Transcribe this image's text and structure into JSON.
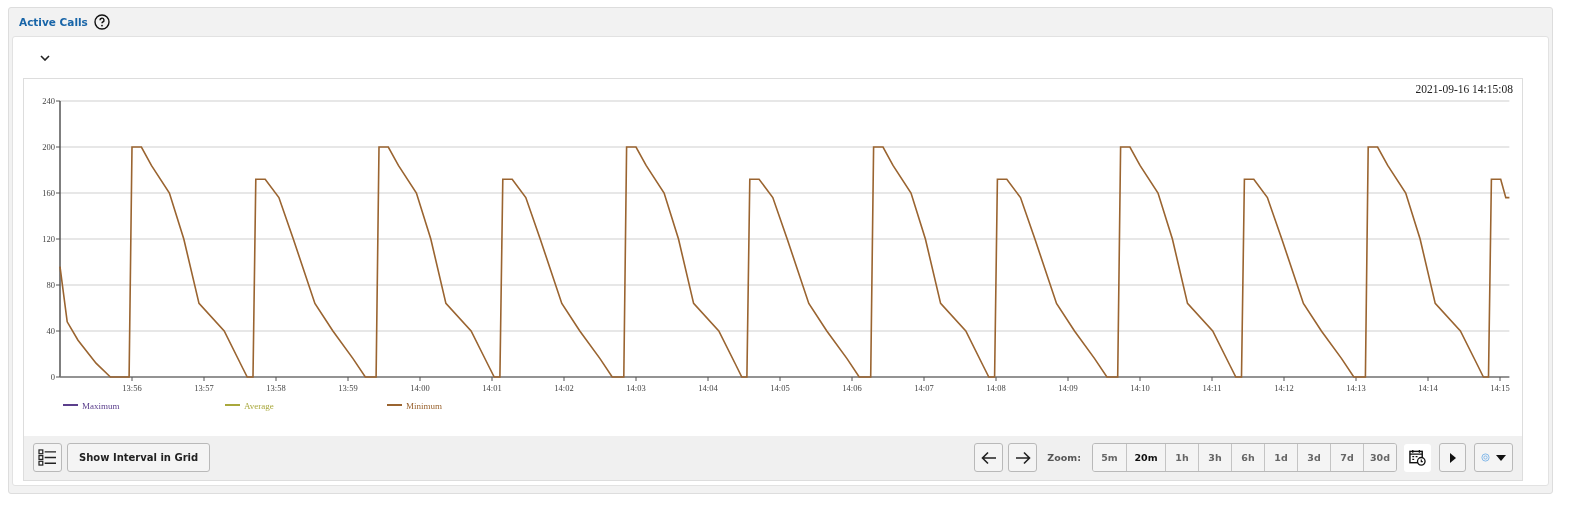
{
  "panel": {
    "title": "Active Calls"
  },
  "chart": {
    "timestamp": "2021-09-16 14:15:08",
    "chart_data": {
      "type": "line",
      "grid": true,
      "legend": "bottom",
      "xlim": [
        835,
        855.13
      ],
      "ylim": [
        0,
        240
      ],
      "yticks": [
        0,
        40,
        80,
        120,
        160,
        200,
        240
      ],
      "xticks": [
        {
          "value": 836,
          "label": "13:56"
        },
        {
          "value": 837,
          "label": "13:57"
        },
        {
          "value": 838,
          "label": "13:58"
        },
        {
          "value": 839,
          "label": "13:59"
        },
        {
          "value": 840,
          "label": "14:00"
        },
        {
          "value": 841,
          "label": "14:01"
        },
        {
          "value": 842,
          "label": "14:02"
        },
        {
          "value": 843,
          "label": "14:03"
        },
        {
          "value": 844,
          "label": "14:04"
        },
        {
          "value": 845,
          "label": "14:05"
        },
        {
          "value": 846,
          "label": "14:06"
        },
        {
          "value": 847,
          "label": "14:07"
        },
        {
          "value": 848,
          "label": "14:08"
        },
        {
          "value": 849,
          "label": "14:09"
        },
        {
          "value": 850,
          "label": "14:10"
        },
        {
          "value": 851,
          "label": "14:11"
        },
        {
          "value": 852,
          "label": "14:12"
        },
        {
          "value": 853,
          "label": "14:13"
        },
        {
          "value": 854,
          "label": "14:14"
        },
        {
          "value": 855,
          "label": "14:15"
        }
      ],
      "x": [
        835,
        835.1,
        835.25,
        835.5,
        835.7,
        835.96,
        836,
        836.13,
        836.27,
        836.52,
        836.72,
        836.93,
        837.28,
        837.52,
        837.6,
        837.68,
        837.72,
        837.85,
        838.04,
        838.24,
        838.54,
        838.79,
        839.07,
        839.24,
        839.39,
        839.43,
        839.56,
        839.7,
        839.95,
        840.15,
        840.36,
        840.71,
        840.95,
        841.03,
        841.11,
        841.15,
        841.28,
        841.47,
        841.67,
        841.97,
        842.22,
        842.5,
        842.67,
        842.83,
        842.87,
        843,
        843.14,
        843.39,
        843.59,
        843.8,
        844.15,
        844.39,
        844.47,
        844.54,
        844.58,
        844.71,
        844.9,
        845.1,
        845.4,
        845.65,
        845.93,
        846.1,
        846.26,
        846.3,
        846.43,
        846.57,
        846.82,
        847.02,
        847.23,
        847.58,
        847.82,
        847.9,
        847.98,
        848.02,
        848.15,
        848.34,
        848.54,
        848.84,
        849.09,
        849.37,
        849.54,
        849.69,
        849.73,
        849.86,
        850,
        850.25,
        850.45,
        850.66,
        851.01,
        851.25,
        851.33,
        851.41,
        851.45,
        851.58,
        851.77,
        851.97,
        852.27,
        852.52,
        852.8,
        852.97,
        853.13,
        853.17,
        853.3,
        853.44,
        853.69,
        853.89,
        854.1,
        854.45,
        854.69,
        854.77,
        854.84,
        854.88,
        855.01,
        855.08,
        855.13
      ],
      "series": [
        {
          "name": "Maximum",
          "color": "#5b3f8c",
          "values": [
            null,
            null,
            null,
            null,
            null,
            null,
            null,
            null,
            null,
            null,
            null,
            null,
            null,
            null,
            null,
            null,
            null,
            null,
            null,
            null,
            null,
            null,
            null,
            null,
            null,
            null,
            null,
            null,
            null,
            null,
            null,
            null,
            null,
            null,
            null,
            null,
            null,
            null,
            null,
            null,
            null,
            null,
            null,
            null,
            null,
            null,
            null,
            null,
            null,
            null,
            null,
            null,
            null,
            null,
            null,
            null,
            null,
            null,
            null,
            null,
            null,
            null,
            null,
            null,
            null,
            null,
            null,
            null,
            null,
            null,
            null,
            null,
            null,
            null,
            null,
            null,
            null,
            null,
            null,
            null,
            null,
            null,
            null,
            null,
            null,
            null,
            null,
            null,
            null,
            null,
            null,
            null,
            null,
            null,
            null,
            null,
            null,
            null,
            null,
            null,
            null,
            null,
            null,
            null,
            null,
            null,
            null,
            null,
            null,
            null,
            null,
            null,
            null,
            null,
            null
          ]
        },
        {
          "name": "Average",
          "color": "#a9a83c",
          "values": [
            null,
            null,
            null,
            null,
            null,
            null,
            null,
            null,
            null,
            null,
            null,
            null,
            null,
            null,
            null,
            null,
            null,
            null,
            null,
            null,
            null,
            null,
            null,
            null,
            null,
            null,
            null,
            null,
            null,
            null,
            null,
            null,
            null,
            null,
            null,
            null,
            null,
            null,
            null,
            null,
            null,
            null,
            null,
            null,
            null,
            null,
            null,
            null,
            null,
            null,
            null,
            null,
            null,
            null,
            null,
            null,
            null,
            null,
            null,
            null,
            null,
            null,
            null,
            null,
            null,
            null,
            null,
            null,
            null,
            null,
            null,
            null,
            null,
            null,
            null,
            null,
            null,
            null,
            null,
            null,
            null,
            null,
            null,
            null,
            null,
            null,
            null,
            null,
            null,
            null,
            null,
            null,
            null,
            null,
            null,
            null,
            null,
            null,
            null,
            null,
            null,
            null,
            null,
            null,
            null,
            null,
            null,
            null,
            null,
            null,
            null,
            null,
            null,
            null,
            null
          ]
        },
        {
          "name": "Minimum",
          "color": "#9a6430",
          "values": [
            96,
            48,
            32,
            12,
            0,
            0,
            200,
            200,
            184,
            160,
            120,
            64,
            40,
            10,
            0,
            0,
            172,
            172,
            156,
            120,
            64,
            40,
            16,
            0,
            0,
            200,
            200,
            184,
            160,
            120,
            64,
            40,
            10,
            0,
            0,
            172,
            172,
            156,
            120,
            64,
            40,
            16,
            0,
            0,
            200,
            200,
            184,
            160,
            120,
            64,
            40,
            10,
            0,
            0,
            172,
            172,
            156,
            120,
            64,
            40,
            16,
            0,
            0,
            200,
            200,
            184,
            160,
            120,
            64,
            40,
            10,
            0,
            0,
            172,
            172,
            156,
            120,
            64,
            40,
            16,
            0,
            0,
            200,
            200,
            184,
            160,
            120,
            64,
            40,
            10,
            0,
            0,
            172,
            172,
            156,
            120,
            64,
            40,
            16,
            0,
            0,
            200,
            200,
            184,
            160,
            120,
            64,
            40,
            10,
            0,
            0,
            172,
            172,
            156,
            156
          ]
        }
      ]
    }
  },
  "toolbar": {
    "grid_button": "Show Interval in Grid",
    "zoom_label": "Zoom:",
    "zoom_options": [
      {
        "label": "5m",
        "selected": false
      },
      {
        "label": "20m",
        "selected": true
      },
      {
        "label": "1h",
        "selected": false
      },
      {
        "label": "3h",
        "selected": false
      },
      {
        "label": "6h",
        "selected": false
      },
      {
        "label": "1d",
        "selected": false
      },
      {
        "label": "3d",
        "selected": false
      },
      {
        "label": "7d",
        "selected": false
      },
      {
        "label": "30d",
        "selected": false
      }
    ]
  }
}
